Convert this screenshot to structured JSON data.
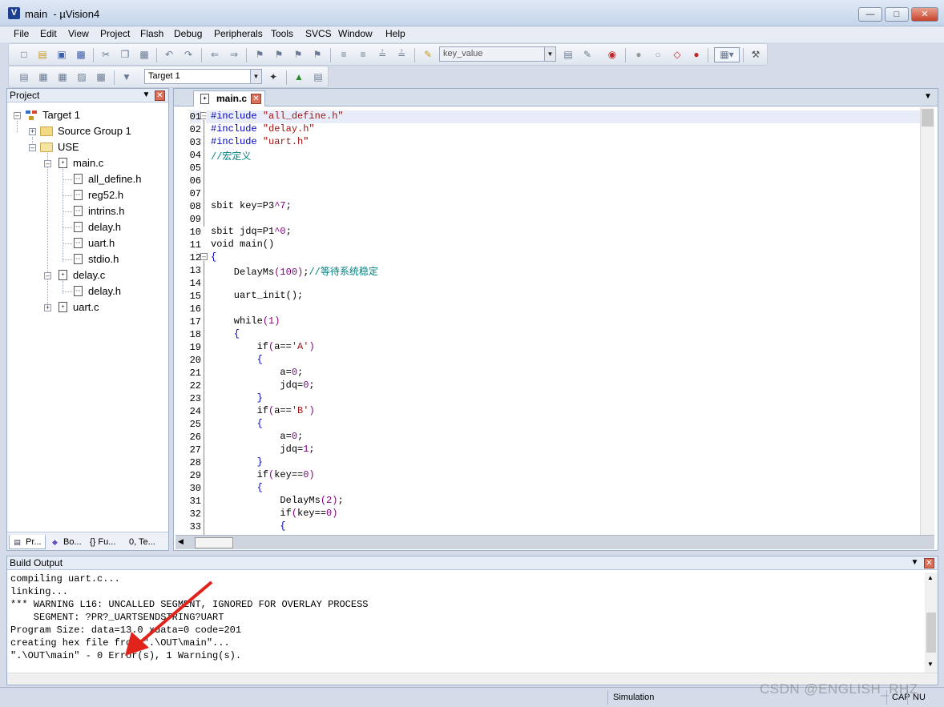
{
  "window": {
    "title": "main  - µVision4",
    "app_icon": "uvision-icon",
    "controls": [
      "minimize",
      "maximize",
      "close"
    ]
  },
  "menu": [
    "File",
    "Edit",
    "View",
    "Project",
    "Flash",
    "Debug",
    "Peripherals",
    "Tools",
    "SVCS",
    "Window",
    "Help"
  ],
  "toolbar": {
    "find_combo_value": "key_value",
    "target_combo_value": "Target 1"
  },
  "project_panel": {
    "title": "Project",
    "tree": {
      "target": "Target 1",
      "source_group": "Source Group 1",
      "use_group": "USE",
      "main_c": "main.c",
      "main_includes": [
        "all_define.h",
        "reg52.h",
        "intrins.h",
        "delay.h",
        "uart.h",
        "stdio.h"
      ],
      "delay_c": "delay.c",
      "delay_includes": [
        "delay.h"
      ],
      "uart_c": "uart.c"
    },
    "tabs": [
      "Pr...",
      "Bo...",
      "{} Fu...",
      "0, Te..."
    ]
  },
  "editor": {
    "tab_label": "main.c",
    "line_numbers": [
      "01",
      "02",
      "03",
      "04",
      "05",
      "06",
      "07",
      "08",
      "09",
      "10",
      "11",
      "12",
      "13",
      "14",
      "15",
      "16",
      "17",
      "18",
      "19",
      "20",
      "21",
      "22",
      "23",
      "24",
      "25",
      "26",
      "27",
      "28",
      "29",
      "30",
      "31",
      "32",
      "33"
    ]
  },
  "build_output": {
    "title": "Build Output",
    "lines": [
      "compiling uart.c...",
      "linking...",
      "*** WARNING L16: UNCALLED SEGMENT, IGNORED FOR OVERLAY PROCESS",
      "    SEGMENT: ?PR?_UARTSENDSTRING?UART",
      "Program Size: data=13.0 xdata=0 code=201",
      "creating hex file from \".\\OUT\\main\"...",
      "\".\\OUT\\main\" - 0 Error(s), 1 Warning(s)."
    ]
  },
  "statusbar": {
    "mode": "Simulation",
    "cap": "CAP",
    "num": "NU"
  },
  "watermark": "CSDN @ENGLISH_RHZ",
  "colors": {
    "preprocessor": "#0000c0",
    "string": "#a31515",
    "comment": "#008080",
    "number": "#7f007f",
    "arrow": "#e0241b"
  }
}
